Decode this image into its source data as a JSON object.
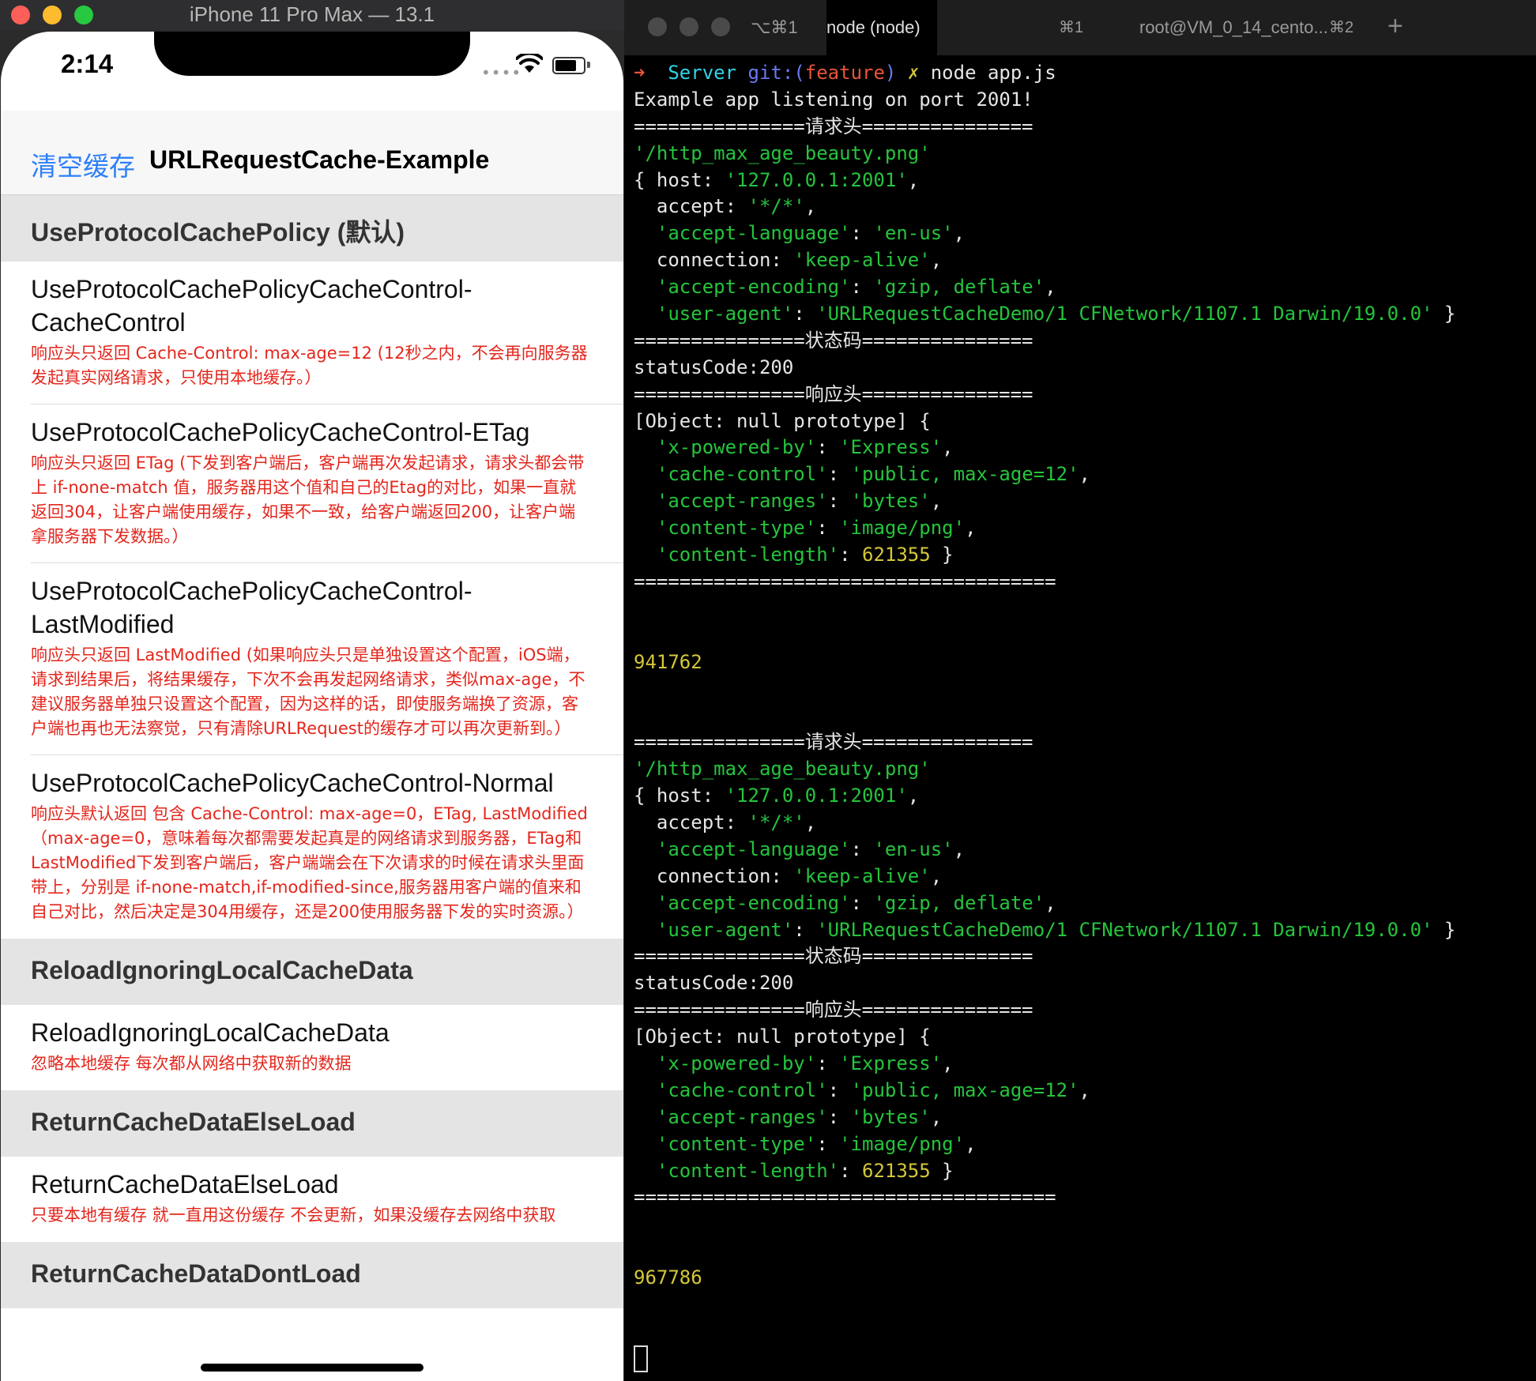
{
  "simulator": {
    "title": "iPhone 11 Pro Max — 13.1",
    "status": {
      "time": "2:14",
      "signal": "••••"
    },
    "nav": {
      "left_button": "清空缓存",
      "title": "URLRequestCache-Example"
    },
    "sections": [
      {
        "header": "UseProtocolCachePolicy (默认)",
        "cells": [
          {
            "title": "UseProtocolCachePolicyCacheControl-CacheControl",
            "desc": "响应头只返回 Cache-Control: max-age=12 (12秒之内，不会再向服务器发起真实网络请求，只使用本地缓存。）"
          },
          {
            "title": "UseProtocolCachePolicyCacheControl-ETag",
            "desc": "响应头只返回 ETag (下发到客户端后，客户端再次发起请求，请求头都会带上 if-none-match 值，服务器用这个值和自己的Etag的对比，如果一直就返回304，让客户端使用缓存，如果不一致，给客户端返回200，让客户端拿服务器下发数据。）"
          },
          {
            "title": "UseProtocolCachePolicyCacheControl-LastModified",
            "desc": "响应头只返回 LastModified (如果响应头只是单独设置这个配置，iOS端，请求到结果后，将结果缓存，下次不会再发起网络请求，类似max-age，不建议服务器单独只设置这个配置，因为这样的话，即使服务端换了资源，客户端也再也无法察觉，只有清除URLRequest的缓存才可以再次更新到。）"
          },
          {
            "title": "UseProtocolCachePolicyCacheControl-Normal",
            "desc": "响应头默认返回 包含 Cache-Control: max-age=0，ETag, LastModified（max-age=0，意味着每次都需要发起真是的网络请求到服务器，ETag和LastModified下发到客户端后，客户端端会在下次请求的时候在请求头里面带上，分别是 if-none-match,if-modified-since,服务器用客户端的值来和自己对比，然后决定是304用缓存，还是200使用服务器下发的实时资源。）"
          }
        ]
      },
      {
        "header": "ReloadIgnoringLocalCacheData",
        "cells": [
          {
            "title": "ReloadIgnoringLocalCacheData",
            "desc": "忽略本地缓存 每次都从网络中获取新的数据"
          }
        ]
      },
      {
        "header": "ReturnCacheDataElseLoad",
        "cells": [
          {
            "title": "ReturnCacheDataElseLoad",
            "desc": "只要本地有缓存 就一直用这份缓存 不会更新，如果没缓存去网络中获取"
          }
        ]
      },
      {
        "header": "ReturnCacheDataDontLoad",
        "cells": []
      }
    ]
  },
  "terminal": {
    "tabs": [
      {
        "label": "⌥⌘1",
        "shortcut": ""
      },
      {
        "label": "node (node)",
        "shortcut": "⌘1"
      },
      {
        "label": "root@VM_0_14_cento...",
        "shortcut": "⌘2"
      }
    ],
    "plus": "+",
    "lines": [
      [
        [
          "r",
          "➜  "
        ],
        [
          "c",
          "Server "
        ],
        [
          "b",
          "git:("
        ],
        [
          "r",
          "feature"
        ],
        [
          "b",
          ")"
        ],
        [
          "y",
          " ✗ "
        ],
        [
          "w",
          "node app.js"
        ]
      ],
      [
        [
          "w",
          "Example app listening on port 2001!"
        ]
      ],
      [
        [
          "w",
          "===============请求头==============="
        ]
      ],
      [
        [
          "g",
          "'/http_max_age_beauty.png'"
        ]
      ],
      [
        [
          "w",
          "{ host: "
        ],
        [
          "g",
          "'127.0.0.1:2001'"
        ],
        [
          "w",
          ","
        ]
      ],
      [
        [
          "w",
          "  accept: "
        ],
        [
          "g",
          "'*/*'"
        ],
        [
          "w",
          ","
        ]
      ],
      [
        [
          "w",
          "  "
        ],
        [
          "g",
          "'accept-language'"
        ],
        [
          "w",
          ": "
        ],
        [
          "g",
          "'en-us'"
        ],
        [
          "w",
          ","
        ]
      ],
      [
        [
          "w",
          "  connection: "
        ],
        [
          "g",
          "'keep-alive'"
        ],
        [
          "w",
          ","
        ]
      ],
      [
        [
          "w",
          "  "
        ],
        [
          "g",
          "'accept-encoding'"
        ],
        [
          "w",
          ": "
        ],
        [
          "g",
          "'gzip, deflate'"
        ],
        [
          "w",
          ","
        ]
      ],
      [
        [
          "w",
          "  "
        ],
        [
          "g",
          "'user-agent'"
        ],
        [
          "w",
          ": "
        ],
        [
          "g",
          "'URLRequestCacheDemo/1 CFNetwork/1107.1 Darwin/19.0.0'"
        ],
        [
          "w",
          " }"
        ]
      ],
      [
        [
          "w",
          "===============状态码==============="
        ]
      ],
      [
        [
          "w",
          "statusCode:200"
        ]
      ],
      [
        [
          "w",
          "===============响应头==============="
        ]
      ],
      [
        [
          "w",
          "[Object: null prototype] {"
        ]
      ],
      [
        [
          "w",
          "  "
        ],
        [
          "g",
          "'x-powered-by'"
        ],
        [
          "w",
          ": "
        ],
        [
          "g",
          "'Express'"
        ],
        [
          "w",
          ","
        ]
      ],
      [
        [
          "w",
          "  "
        ],
        [
          "g",
          "'cache-control'"
        ],
        [
          "w",
          ": "
        ],
        [
          "g",
          "'public, max-age=12'"
        ],
        [
          "w",
          ","
        ]
      ],
      [
        [
          "w",
          "  "
        ],
        [
          "g",
          "'accept-ranges'"
        ],
        [
          "w",
          ": "
        ],
        [
          "g",
          "'bytes'"
        ],
        [
          "w",
          ","
        ]
      ],
      [
        [
          "w",
          "  "
        ],
        [
          "g",
          "'content-type'"
        ],
        [
          "w",
          ": "
        ],
        [
          "g",
          "'image/png'"
        ],
        [
          "w",
          ","
        ]
      ],
      [
        [
          "w",
          "  "
        ],
        [
          "g",
          "'content-length'"
        ],
        [
          "w",
          ": "
        ],
        [
          "y",
          "621355"
        ],
        [
          "w",
          " }"
        ]
      ],
      [
        [
          "w",
          "====================================="
        ]
      ],
      [],
      [],
      [
        [
          "y",
          "941762"
        ]
      ],
      [],
      [],
      [
        [
          "w",
          "===============请求头==============="
        ]
      ],
      [
        [
          "g",
          "'/http_max_age_beauty.png'"
        ]
      ],
      [
        [
          "w",
          "{ host: "
        ],
        [
          "g",
          "'127.0.0.1:2001'"
        ],
        [
          "w",
          ","
        ]
      ],
      [
        [
          "w",
          "  accept: "
        ],
        [
          "g",
          "'*/*'"
        ],
        [
          "w",
          ","
        ]
      ],
      [
        [
          "w",
          "  "
        ],
        [
          "g",
          "'accept-language'"
        ],
        [
          "w",
          ": "
        ],
        [
          "g",
          "'en-us'"
        ],
        [
          "w",
          ","
        ]
      ],
      [
        [
          "w",
          "  connection: "
        ],
        [
          "g",
          "'keep-alive'"
        ],
        [
          "w",
          ","
        ]
      ],
      [
        [
          "w",
          "  "
        ],
        [
          "g",
          "'accept-encoding'"
        ],
        [
          "w",
          ": "
        ],
        [
          "g",
          "'gzip, deflate'"
        ],
        [
          "w",
          ","
        ]
      ],
      [
        [
          "w",
          "  "
        ],
        [
          "g",
          "'user-agent'"
        ],
        [
          "w",
          ": "
        ],
        [
          "g",
          "'URLRequestCacheDemo/1 CFNetwork/1107.1 Darwin/19.0.0'"
        ],
        [
          "w",
          " }"
        ]
      ],
      [
        [
          "w",
          "===============状态码==============="
        ]
      ],
      [
        [
          "w",
          "statusCode:200"
        ]
      ],
      [
        [
          "w",
          "===============响应头==============="
        ]
      ],
      [
        [
          "w",
          "[Object: null prototype] {"
        ]
      ],
      [
        [
          "w",
          "  "
        ],
        [
          "g",
          "'x-powered-by'"
        ],
        [
          "w",
          ": "
        ],
        [
          "g",
          "'Express'"
        ],
        [
          "w",
          ","
        ]
      ],
      [
        [
          "w",
          "  "
        ],
        [
          "g",
          "'cache-control'"
        ],
        [
          "w",
          ": "
        ],
        [
          "g",
          "'public, max-age=12'"
        ],
        [
          "w",
          ","
        ]
      ],
      [
        [
          "w",
          "  "
        ],
        [
          "g",
          "'accept-ranges'"
        ],
        [
          "w",
          ": "
        ],
        [
          "g",
          "'bytes'"
        ],
        [
          "w",
          ","
        ]
      ],
      [
        [
          "w",
          "  "
        ],
        [
          "g",
          "'content-type'"
        ],
        [
          "w",
          ": "
        ],
        [
          "g",
          "'image/png'"
        ],
        [
          "w",
          ","
        ]
      ],
      [
        [
          "w",
          "  "
        ],
        [
          "g",
          "'content-length'"
        ],
        [
          "w",
          ": "
        ],
        [
          "y",
          "621355"
        ],
        [
          "w",
          " }"
        ]
      ],
      [
        [
          "w",
          "====================================="
        ]
      ],
      [],
      [],
      [
        [
          "y",
          "967786"
        ]
      ],
      [],
      []
    ]
  }
}
